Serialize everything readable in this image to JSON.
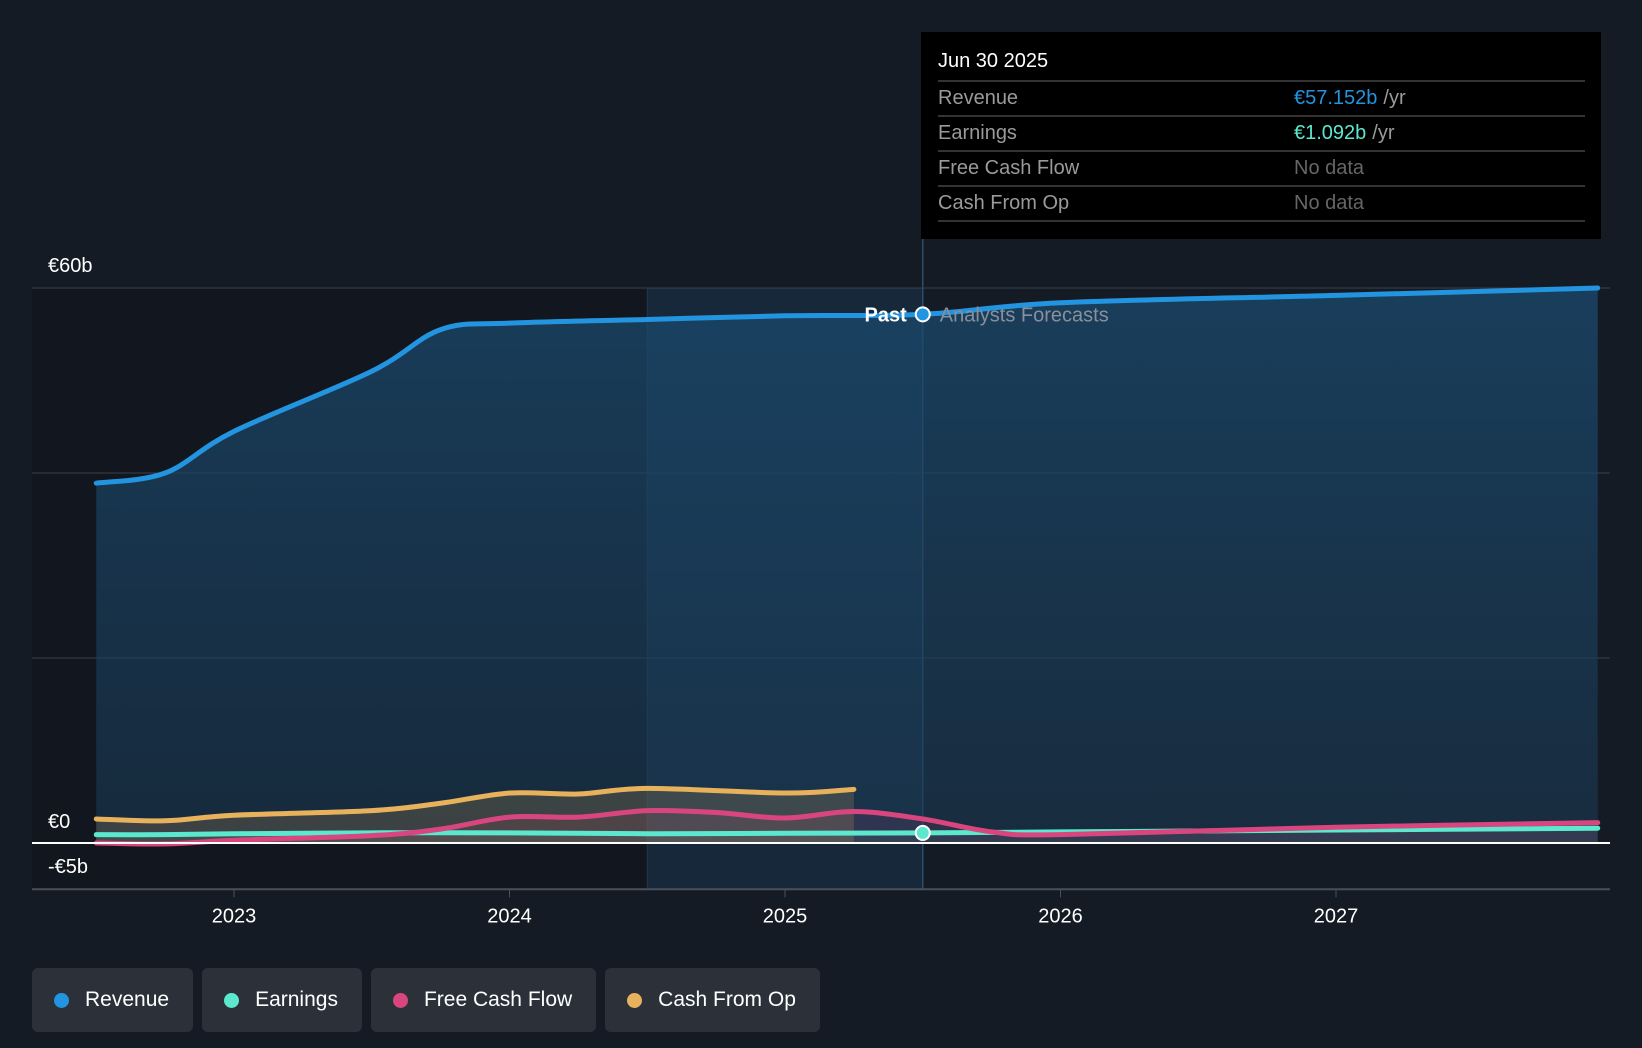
{
  "tooltip": {
    "date": "Jun 30 2025",
    "rows": [
      {
        "label": "Revenue",
        "value": "€57.152b",
        "unit": "/yr",
        "color": "#2394e0"
      },
      {
        "label": "Earnings",
        "value": "€1.092b",
        "unit": "/yr",
        "color": "#5ce8cf"
      },
      {
        "label": "Free Cash Flow",
        "value": "No data"
      },
      {
        "label": "Cash From Op",
        "value": "No data"
      }
    ]
  },
  "chart_data": {
    "type": "line",
    "title": "",
    "xlabel": "",
    "ylabel": "",
    "ylim": [
      -5,
      60
    ],
    "xlim": [
      2022.3,
      2027.95
    ],
    "y_tick_labels": [
      {
        "value": 60,
        "label": "€60b"
      },
      {
        "value": 0,
        "label": "€0"
      },
      {
        "value": -5,
        "label": "-€5b"
      }
    ],
    "y_gridlines": [
      20,
      40,
      60
    ],
    "x_ticks": [
      {
        "value": 2023,
        "label": "2023"
      },
      {
        "value": 2024,
        "label": "2024"
      },
      {
        "value": 2025,
        "label": "2025"
      },
      {
        "value": 2026,
        "label": "2026"
      },
      {
        "value": 2027,
        "label": "2027"
      }
    ],
    "past_label": "Past",
    "forecast_label": "Analysts Forecasts",
    "divider_x": 2025.5,
    "highlight_start_x": 2024.5,
    "series": [
      {
        "name": "Revenue",
        "color": "#2394e0",
        "points": [
          [
            2022.5,
            38.9
          ],
          [
            2022.75,
            40
          ],
          [
            2023,
            44.5
          ],
          [
            2023.5,
            51
          ],
          [
            2023.75,
            55.5
          ],
          [
            2024,
            56.2
          ],
          [
            2024.5,
            56.6
          ],
          [
            2025,
            57
          ],
          [
            2025.5,
            57.15
          ],
          [
            2026,
            58.4
          ],
          [
            2027,
            59.2
          ],
          [
            2027.95,
            60
          ]
        ]
      },
      {
        "name": "Earnings",
        "color": "#5ce8cf",
        "points": [
          [
            2022.5,
            0.9
          ],
          [
            2022.75,
            0.9
          ],
          [
            2023,
            1
          ],
          [
            2023.5,
            1.1
          ],
          [
            2024,
            1.1
          ],
          [
            2024.5,
            1
          ],
          [
            2025,
            1.05
          ],
          [
            2025.5,
            1.09
          ],
          [
            2026,
            1.2
          ],
          [
            2027,
            1.4
          ],
          [
            2027.95,
            1.6
          ]
        ]
      },
      {
        "name": "Free Cash Flow",
        "color": "#d9467f",
        "points": [
          [
            2022.5,
            0
          ],
          [
            2022.75,
            -0.1
          ],
          [
            2023,
            0.3
          ],
          [
            2023.5,
            0.8
          ],
          [
            2023.75,
            1.5
          ],
          [
            2024,
            2.8
          ],
          [
            2024.25,
            2.8
          ],
          [
            2024.5,
            3.5
          ],
          [
            2024.75,
            3.3
          ],
          [
            2025,
            2.7
          ],
          [
            2025.25,
            3.4
          ],
          [
            2025.5,
            2.6
          ],
          [
            2025.75,
            1.2
          ],
          [
            2026,
            0.9
          ],
          [
            2027,
            1.7
          ],
          [
            2027.95,
            2.2
          ]
        ]
      },
      {
        "name": "Cash From Op",
        "color": "#e8b15c",
        "points": [
          [
            2022.5,
            2.6
          ],
          [
            2022.75,
            2.4
          ],
          [
            2023,
            3.0
          ],
          [
            2023.5,
            3.5
          ],
          [
            2023.75,
            4.3
          ],
          [
            2024,
            5.4
          ],
          [
            2024.25,
            5.3
          ],
          [
            2024.5,
            5.9
          ],
          [
            2025,
            5.4
          ],
          [
            2025.25,
            5.8
          ]
        ]
      }
    ],
    "legend": "bottom"
  }
}
